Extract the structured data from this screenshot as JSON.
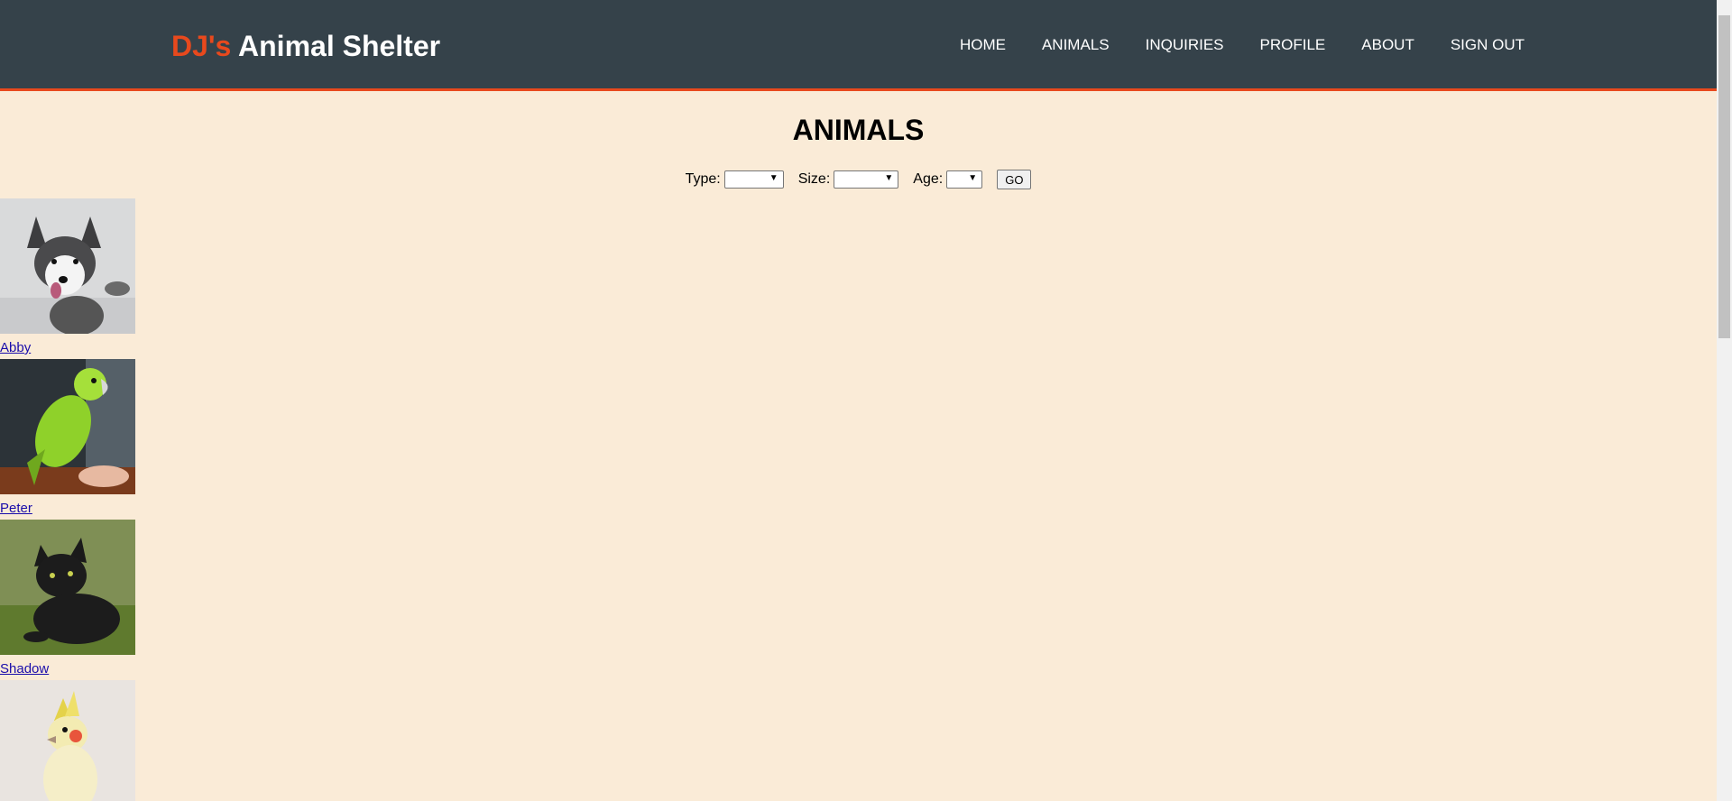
{
  "header": {
    "brand_highlight": "DJ's",
    "brand_rest": " Animal Shelter",
    "nav": [
      "HOME",
      "ANIMALS",
      "INQUIRIES",
      "PROFILE",
      "ABOUT",
      "SIGN OUT"
    ]
  },
  "main": {
    "title": "ANIMALS",
    "filters": {
      "type_label": "Type:",
      "size_label": "Size:",
      "age_label": "Age:",
      "go_label": "GO"
    }
  },
  "animals": [
    {
      "name": "Abby"
    },
    {
      "name": "Peter"
    },
    {
      "name": "Shadow"
    },
    {
      "name": ""
    }
  ],
  "colors": {
    "header_bg": "#35424a",
    "accent": "#e8491d",
    "page_bg": "#faebd7",
    "link": "#1a0dab"
  }
}
